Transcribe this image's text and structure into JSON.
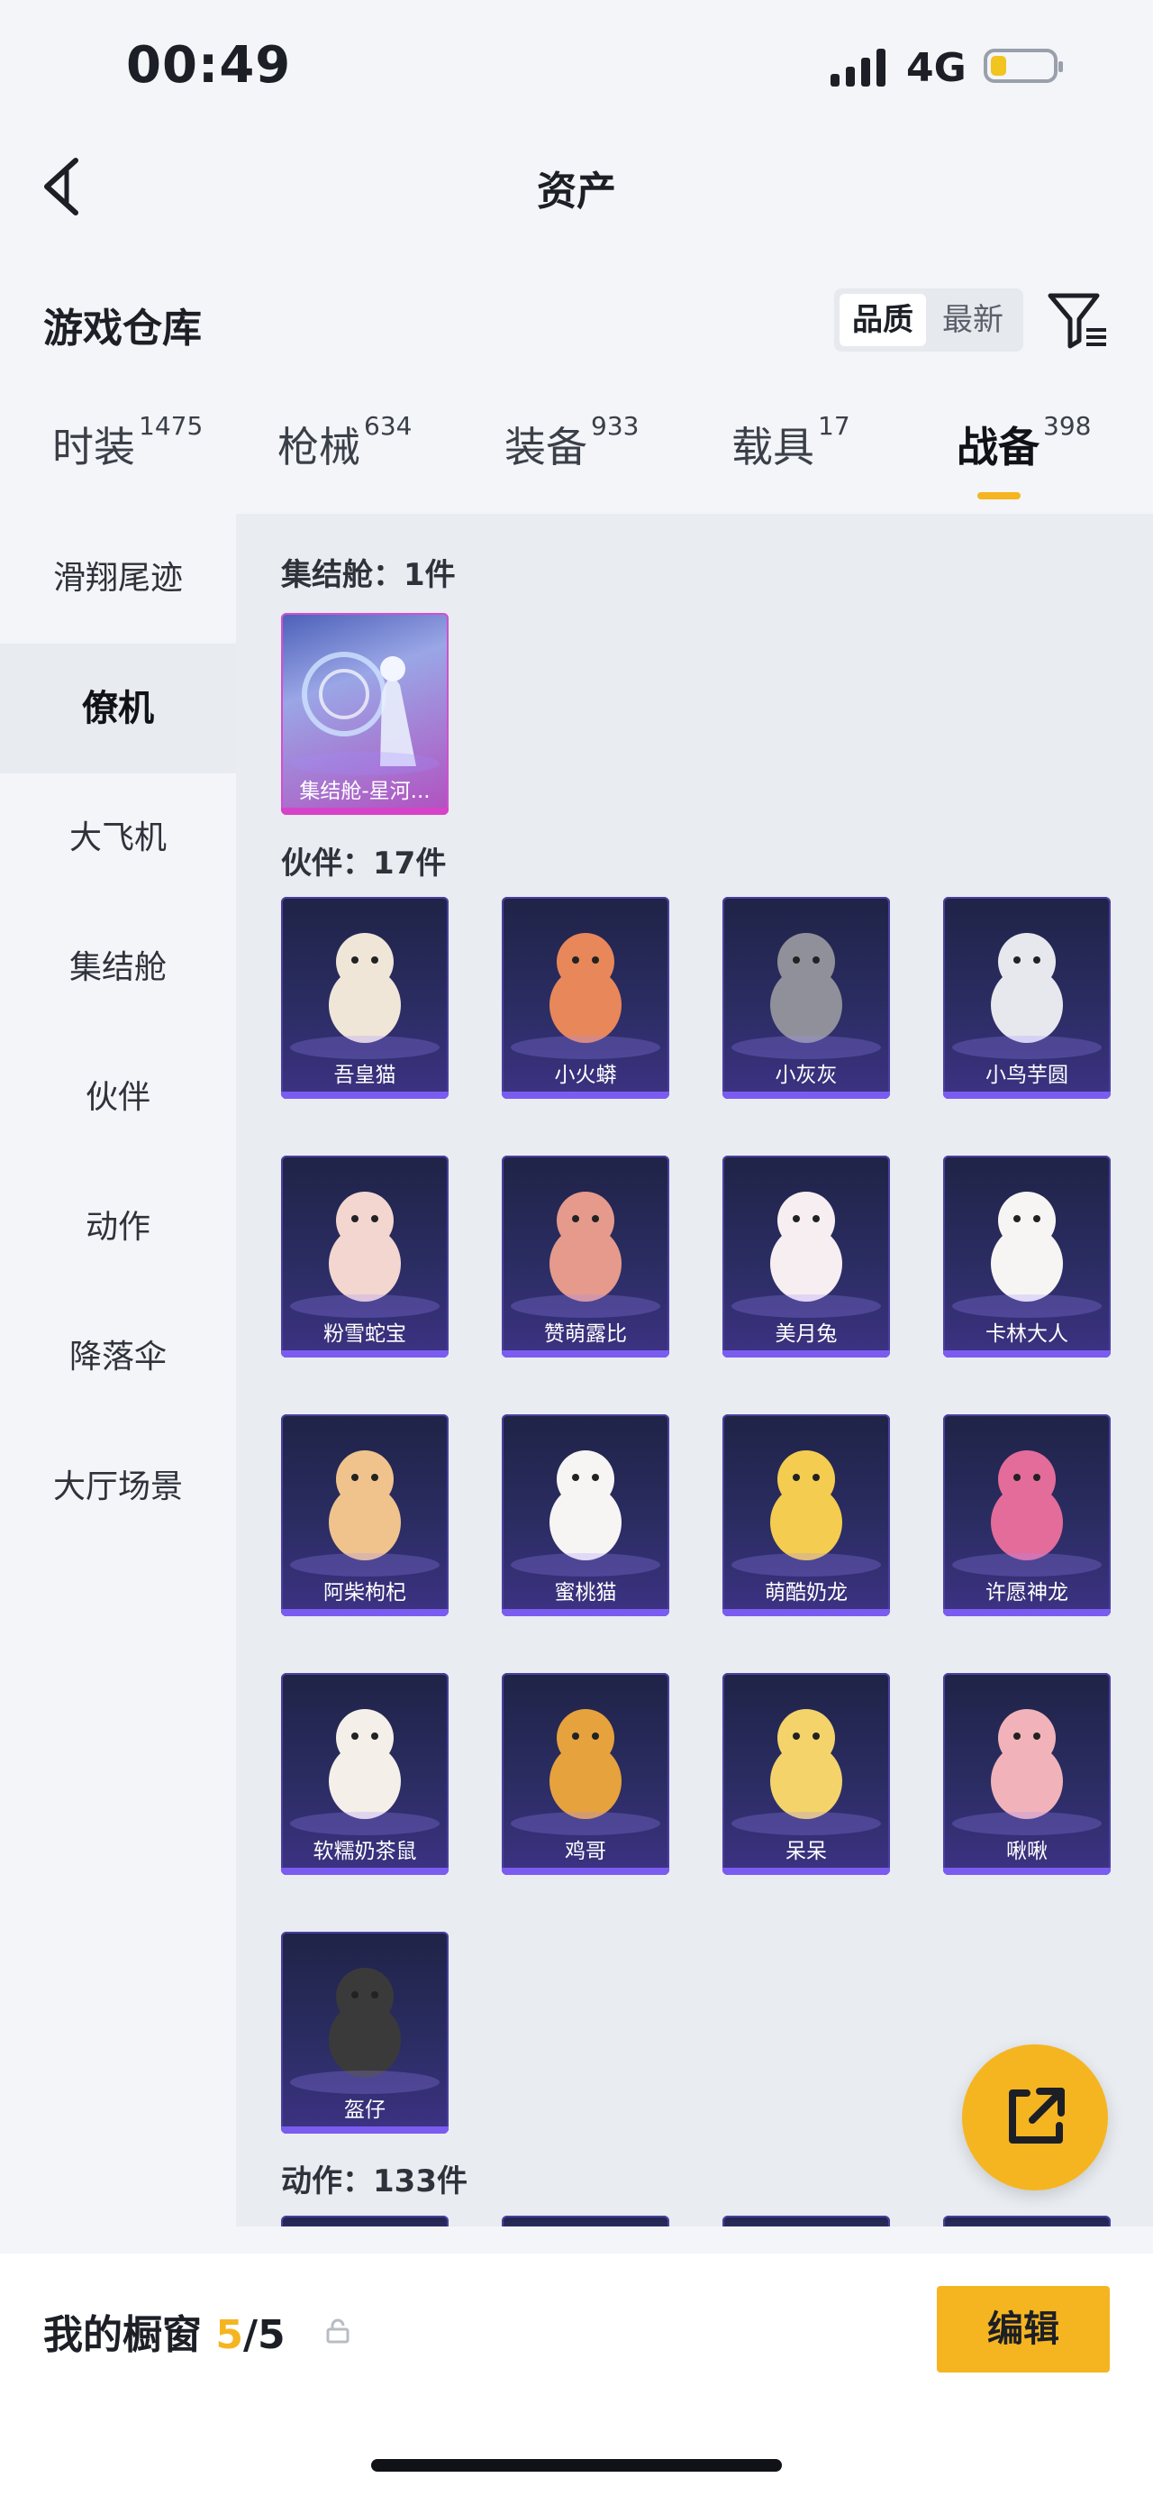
{
  "status_bar": {
    "time": "00:49",
    "network": "4G",
    "battery_level": 0.25
  },
  "nav": {
    "title": "资产"
  },
  "section": {
    "title": "游戏仓库",
    "sort_quality": "品质",
    "sort_newest": "最新"
  },
  "tabs": [
    {
      "label": "时装",
      "count": "1475"
    },
    {
      "label": "枪械",
      "count": "634"
    },
    {
      "label": "装备",
      "count": "933"
    },
    {
      "label": "载具",
      "count": "17"
    },
    {
      "label": "战备",
      "count": "398",
      "active": true
    }
  ],
  "sidebar": {
    "items": [
      "滑翔尾迹",
      "僚机",
      "大飞机",
      "集结舱",
      "伙伴",
      "动作",
      "降落伞",
      "大厅场景"
    ],
    "active": "僚机"
  },
  "groups": [
    {
      "title": "集结舱：1件",
      "items": [
        "集结舱-星河..."
      ]
    },
    {
      "title": "伙伴：17件",
      "items": [
        "吾皇猫",
        "小火蟒",
        "小灰灰",
        "小鸟芋圆",
        "粉雪蛇宝",
        "赞萌露比",
        "美月兔",
        "卡林大人",
        "阿柴枸杞",
        "蜜桃猫",
        "萌酷奶龙",
        "许愿神龙",
        "软糯奶茶鼠",
        "鸡哥",
        "呆呆",
        "啾啾",
        "盔仔"
      ]
    },
    {
      "title": "动作：133件",
      "items": []
    }
  ],
  "bottom_bar": {
    "showcase_label": "我的橱窗",
    "showcase_current": "5",
    "showcase_total": "/5",
    "edit_label": "编辑"
  },
  "colors": {
    "accent": "#f5b521",
    "card_purple": "#3d3284",
    "special_magenta": "#d642c8"
  }
}
